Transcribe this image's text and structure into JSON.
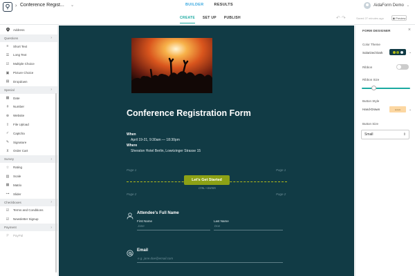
{
  "topbar": {
    "form_title": "Conference Regist...",
    "main_tabs": [
      "BUILDER",
      "RESULTS"
    ],
    "active_main_tab": "BUILDER",
    "sub_tabs": [
      "CREATE",
      "SET UP",
      "PUBLISH"
    ],
    "active_sub_tab": "CREATE",
    "saved_text": "Saved 27 minutes ago",
    "preview_label": "Preview",
    "user_name": "AidaForm Demo"
  },
  "sidebar": {
    "top_item": "Address",
    "sections": [
      {
        "title": "Questions",
        "items": [
          "Short Text",
          "Long Text",
          "Multiple Choice",
          "Picture Choice",
          "Dropdown"
        ]
      },
      {
        "title": "Special",
        "items": [
          "Date",
          "Number",
          "Website",
          "File Upload",
          "Captcha",
          "Signature",
          "Order Cart"
        ]
      },
      {
        "title": "Survey",
        "items": [
          "Rating",
          "Scale",
          "Matrix",
          "Slider"
        ]
      },
      {
        "title": "Checkboxes",
        "items": [
          "Terms and Conditions",
          "Newsletter Signup"
        ]
      },
      {
        "title": "Payment",
        "items": [
          "PayPal"
        ]
      }
    ]
  },
  "form": {
    "heading": "Conference Registration Form",
    "when_label": "When",
    "when_value": "April 19-21, 9:30am — 18:30pm",
    "where_label": "Where",
    "where_value": "Sheraton Hotel Berlin, Lowrizinger Strasse 15",
    "page_labels": [
      "Page 1",
      "Page 1",
      "Page 2",
      "Page 2"
    ],
    "start_button": "Let's Get Started",
    "ctrl_hint": "CTRL + ENTER",
    "fields": {
      "name": {
        "title": "Attendee's Full Name",
        "first_label": "First Name",
        "first_placeholder": "Jane",
        "last_label": "Last Name",
        "last_placeholder": "Doe"
      },
      "email": {
        "title": "Email",
        "placeholder": "e.g. jane.doe@email.com"
      }
    }
  },
  "designer": {
    "title": "FORM DESIGNER",
    "color_theme_label": "Color Theme",
    "color_theme_value": "Solarized Dark",
    "swatch_colors": [
      "#b6bd1a",
      "#8ca115",
      "#e6eef0"
    ],
    "ribbon_label": "Ribbon",
    "ribbon_on": false,
    "ribbon_size_label": "Ribbon Size",
    "ribbon_size_level": 0.2,
    "button_style_label": "Button Style",
    "button_style_value": "Hand-Drawn",
    "button_style_preview": "Lorem",
    "button_size_label": "Button Size",
    "button_size_value": "Small"
  },
  "colors": {
    "canvas_bg": "#113b45",
    "accent": "#1aa9a0",
    "start_button": "#8ca115",
    "dashed_line": "#b6bd1a"
  }
}
